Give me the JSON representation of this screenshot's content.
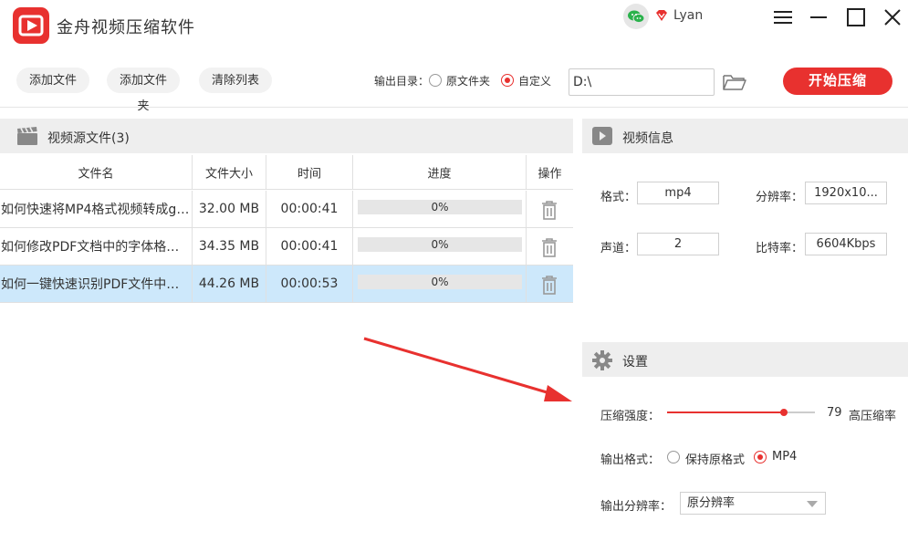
{
  "app": {
    "title": "金舟视频压缩软件",
    "user": "Lyan"
  },
  "toolbar": {
    "add_file": "添加文件",
    "add_folder": "添加文件夹",
    "clear_list": "清除列表",
    "output_dir_label": "输出目录：",
    "option_source_folder": "原文件夹",
    "option_custom": "自定义",
    "selected_option": "custom",
    "output_path": "D:\\",
    "start_button": "开始压缩"
  },
  "file_list": {
    "title": "视频源文件(3)",
    "columns": [
      "文件名",
      "文件大小",
      "时间",
      "进度",
      "操作"
    ],
    "rows": [
      {
        "name": "如何快速将MP4格式视频转成gif...",
        "size": "32.00 MB",
        "time": "00:00:41",
        "progress_text": "0%",
        "progress": 0,
        "selected": false
      },
      {
        "name": "如何修改PDF文档中的字体格式...",
        "size": "34.35 MB",
        "time": "00:00:41",
        "progress_text": "0%",
        "progress": 0,
        "selected": false
      },
      {
        "name": "如何一键快速识别PDF文件中的...",
        "size": "44.26 MB",
        "time": "00:00:53",
        "progress_text": "0%",
        "progress": 0,
        "selected": true
      }
    ]
  },
  "video_info": {
    "title": "视频信息",
    "format_label": "格式：",
    "format_value": "mp4",
    "resolution_label": "分辨率：",
    "resolution_value": "1920x10...",
    "channel_label": "声道：",
    "channel_value": "2",
    "bitrate_label": "比特率：",
    "bitrate_value": "6604Kbps"
  },
  "settings": {
    "title": "设置",
    "strength_label": "压缩强度：",
    "strength_value": 79,
    "strength_display": "79",
    "strength_desc": "高压缩率",
    "output_format_label": "输出格式：",
    "format_option_keep": "保持原格式",
    "format_option_mp4": "MP4",
    "selected_format": "mp4",
    "output_resolution_label": "输出分辨率：",
    "output_resolution_value": "原分辨率"
  },
  "colors": {
    "accent": "#e8312f",
    "selected_row": "#cde8fb",
    "panel_header": "#eeeeee"
  }
}
